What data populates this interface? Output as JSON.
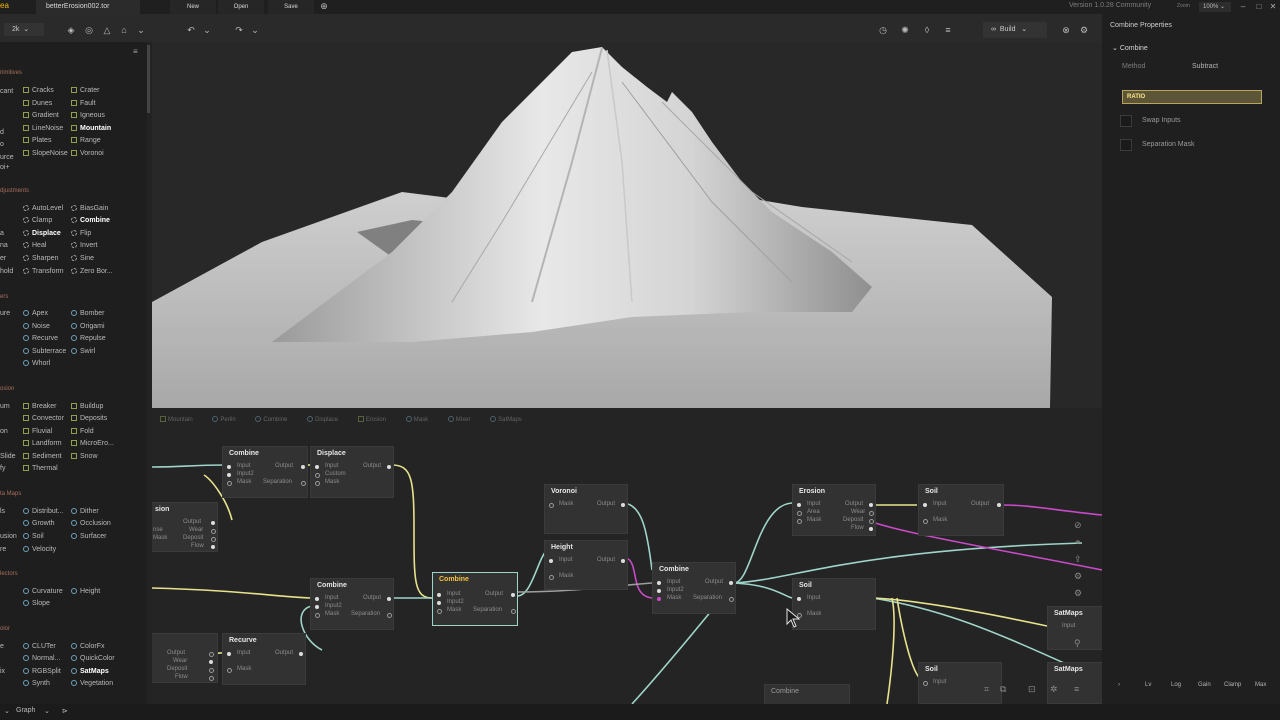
{
  "app": {
    "logo_text": "ea",
    "file_tab": "betterErosion002.tor",
    "new_label": "New",
    "open_label": "Open",
    "save_label": "Save",
    "version": "Version 1.0.28 Community",
    "zoom_label": "Zoom",
    "zoom_value": "100%"
  },
  "toolbar": {
    "resolution": "2k",
    "build_label": "Build"
  },
  "library": {
    "categories": {
      "primitives": "rimitives",
      "adjustments": "djustments",
      "filters": "ers",
      "erosion": "osion",
      "data_maps": "ta Maps",
      "selectors": "lectors",
      "color": "olor"
    },
    "primitives_col0": [
      "cant",
      "",
      "",
      "d",
      "o",
      "urce",
      "oi+"
    ],
    "primitives_col1": [
      "Cracks",
      "Dunes",
      "Gradient",
      "LineNoise",
      "Plates",
      "SlopeNoise"
    ],
    "primitives_col2": [
      "Crater",
      "Fault",
      "Igneous",
      "Mountain",
      "Range",
      "Voronoi"
    ],
    "adjust_col0": [
      "",
      "",
      "a",
      "na",
      "er",
      "hold"
    ],
    "adjust_col1": [
      "AutoLevel",
      "Clamp",
      "Displace",
      "Heal",
      "Sharpen",
      "Transform"
    ],
    "adjust_col2": [
      "BiasGain",
      "Combine",
      "Flip",
      "Invert",
      "Sine",
      "Zero Bor..."
    ],
    "filters_col0": [
      "ure",
      "",
      "",
      "",
      ""
    ],
    "filters_col1": [
      "Apex",
      "Noise",
      "Recurve",
      "Subterrace",
      "Whorl"
    ],
    "filters_col2": [
      "Bomber",
      "Origami",
      "Repulse",
      "Swirl"
    ],
    "erosion_col0": [
      "um",
      "",
      "on",
      "",
      "Slide",
      "fy"
    ],
    "erosion_col1": [
      "Breaker",
      "Convector",
      "Fluvial",
      "Landform",
      "Sediment",
      "Thermal"
    ],
    "erosion_col2": [
      "Buildup",
      "Deposits",
      "Fold",
      "MicroEro...",
      "Snow"
    ],
    "data_col0": [
      "ls",
      "",
      "usion",
      "re"
    ],
    "data_col1": [
      "Distribut...",
      "Growth",
      "Soil",
      "Velocity"
    ],
    "data_col2": [
      "Dither",
      "Occlusion",
      "Surfacer"
    ],
    "sel_col1": [
      "Curvature",
      "Slope"
    ],
    "sel_col2": [
      "Height"
    ],
    "color_col0": [
      "e",
      "",
      "ix",
      ""
    ],
    "color_col1": [
      "CLUTer",
      "Normal...",
      "RGBSplit",
      "Synth"
    ],
    "color_col2": [
      "ColorFx",
      "QuickColor",
      "SatMaps",
      "Vegetation"
    ]
  },
  "graph": {
    "breadcrumbs": [
      "Mountain",
      "Perlin",
      "Combine",
      "Displace",
      "Erosion",
      "Mask",
      "Mixer",
      "SatMaps"
    ],
    "nodes": {
      "combine1": {
        "title": "Combine",
        "in1": "Input",
        "in2": "Input2",
        "in3": "Mask",
        "out1": "Output",
        "out2": "Separation"
      },
      "displace": {
        "title": "Displace",
        "in1": "Input",
        "in2": "Custom",
        "in3": "Mask",
        "out1": "Output"
      },
      "erosion_left": {
        "title": "sion",
        "out1": "Output",
        "out2": "Wear",
        "out3": "Deposit",
        "out4": "Flow",
        "in1": "nse",
        "in2": "Mask"
      },
      "combine2": {
        "title": "Combine",
        "in1": "Input",
        "in2": "Input2",
        "in3": "Mask",
        "out1": "Output",
        "out2": "Separation"
      },
      "combine_sel": {
        "title": "Combine",
        "in1": "Input",
        "in2": "Input2",
        "in3": "Mask",
        "out1": "Output",
        "out2": "Separation"
      },
      "recurve": {
        "title": "Recurve",
        "in1": "Input",
        "in2": "Mask",
        "out1": "Output"
      },
      "erosion_bl": {
        "out1": "Output",
        "out2": "Wear",
        "out3": "Deposit",
        "out4": "Flow"
      },
      "voronoi": {
        "title": "Voronoi",
        "in1": "Mask",
        "out1": "Output"
      },
      "height": {
        "title": "Height",
        "in1": "Input",
        "in2": "Mask",
        "out1": "Output"
      },
      "combine3": {
        "title": "Combine",
        "in1": "Input",
        "in2": "Input2",
        "in3": "Mask",
        "out1": "Output",
        "out2": "Separation"
      },
      "erosion": {
        "title": "Erosion",
        "in1": "Input",
        "in2": "Area",
        "in3": "Mask",
        "out1": "Output",
        "out2": "Wear",
        "out3": "Deposit",
        "out4": "Flow"
      },
      "soil1": {
        "title": "Soil",
        "in1": "Input",
        "in2": "Mask",
        "out1": "Output"
      },
      "soil2": {
        "title": "Soil",
        "in1": "Input",
        "in2": "Mask"
      },
      "soil3": {
        "title": "Soil",
        "in1": "Input"
      },
      "satmaps1": {
        "title": "SatMaps",
        "in1": "Input"
      },
      "satmaps2": {
        "title": "SatMaps"
      },
      "combine_bottom": {
        "title": "Combine"
      }
    }
  },
  "properties": {
    "title": "Combine Properties",
    "section": "Combine",
    "method_label": "Method",
    "method_value": "Subtract",
    "ratio_label": "RATIO",
    "swap_inputs": "Swap Inputs",
    "separation_mask": "Separation Mask",
    "tabs": [
      "Lv",
      "Log",
      "Gain",
      "Clamp",
      "Max"
    ]
  },
  "bottom": {
    "view_label": "Graph"
  },
  "colors": {
    "accent_yellow": "#f4c23c",
    "wire_teal": "#9fd4c9",
    "wire_yellow": "#e6e38c",
    "wire_magenta": "#c84ac8",
    "ratio_fill": "#5c5537"
  }
}
